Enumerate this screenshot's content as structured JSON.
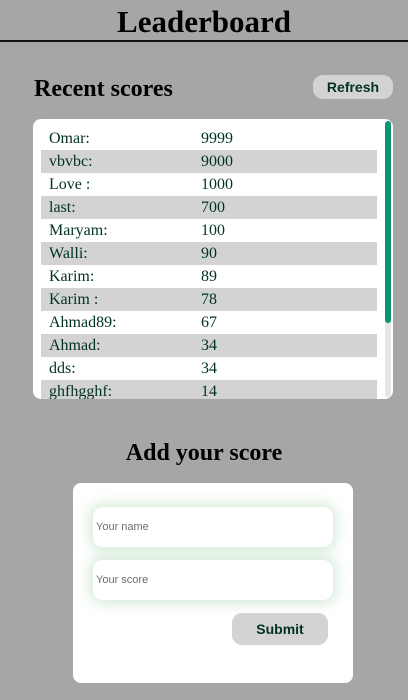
{
  "header": {
    "title": "Leaderboard"
  },
  "recent": {
    "heading": "Recent scores",
    "refresh_label": "Refresh",
    "scores": [
      {
        "name": "Omar:",
        "score": "9999"
      },
      {
        "name": "vbvbc:",
        "score": "9000"
      },
      {
        "name": "Love :",
        "score": "1000"
      },
      {
        "name": "last:",
        "score": "700"
      },
      {
        "name": "Maryam:",
        "score": "100"
      },
      {
        "name": "Walli:",
        "score": "90"
      },
      {
        "name": "Karim:",
        "score": "89"
      },
      {
        "name": "Karim :",
        "score": "78"
      },
      {
        "name": "Ahmad89:",
        "score": "67"
      },
      {
        "name": "Ahmad:",
        "score": "34"
      },
      {
        "name": "dds:",
        "score": "34"
      },
      {
        "name": "ghfhgghf:",
        "score": "14"
      }
    ]
  },
  "form": {
    "heading": "Add your score",
    "name_placeholder": "Your name",
    "score_placeholder": "Your score",
    "submit_label": "Submit"
  },
  "colors": {
    "accent": "#0a9577",
    "text": "#013220"
  }
}
